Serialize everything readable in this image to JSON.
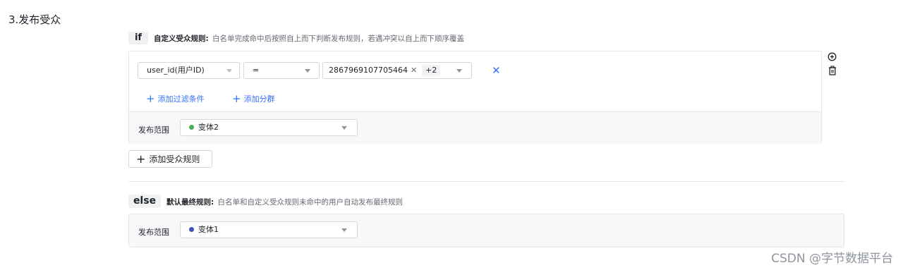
{
  "section": {
    "title": "3.发布受众"
  },
  "if_rule": {
    "keyword": "if",
    "desc_bold": "自定义受众规则:",
    "desc_text": "白名单完成命中后按照自上而下判断发布规则，若遇冲突以自上而下顺序覆盖",
    "condition": {
      "field_value": "user_id(用户ID)",
      "operator_value": "=",
      "value_chip": "2867969107705464",
      "more_count": "+2"
    },
    "add_filter_label": "添加过滤条件",
    "add_group_label": "添加分群",
    "scope_label": "发布范围",
    "scope_value": "变体2",
    "scope_dot_color": "#4caf50"
  },
  "add_rule_label": "添加受众规则",
  "else_rule": {
    "keyword": "else",
    "desc_bold": "默认最终规则:",
    "desc_text": "白名单和自定义受众规则未命中的用户自动发布最终规则",
    "scope_label": "发布范围",
    "scope_value": "变体1",
    "scope_dot_color": "#3f51b5"
  },
  "icons": {
    "add": "plus-circle-icon",
    "delete": "trash-icon",
    "remove": "close-icon"
  },
  "accent_color": "#3370ff",
  "watermark": "CSDN @字节数据平台"
}
